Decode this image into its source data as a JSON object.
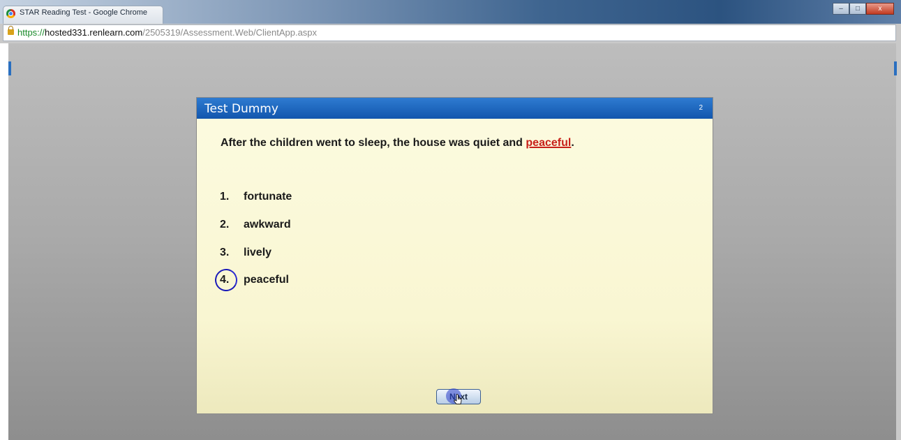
{
  "browser": {
    "window_title": "STAR Reading Test - Google Chrome",
    "url_scheme": "https://",
    "url_host": "hosted331.renlearn.com",
    "url_path": "/2505319/Assessment.Web/ClientApp.aspx",
    "controls": {
      "minimize": "–",
      "maximize": "□",
      "close": "x"
    }
  },
  "test": {
    "student_name": "Test Dummy",
    "question_number": "2",
    "question_text": "After the children went to sleep, the house was quiet and ",
    "underlined_word": "peaceful",
    "question_end": ".",
    "choices": [
      {
        "number": "1.",
        "text": "fortunate"
      },
      {
        "number": "2.",
        "text": "awkward"
      },
      {
        "number": "3.",
        "text": "lively"
      },
      {
        "number": "4.",
        "text": "peaceful"
      }
    ],
    "selected_choice": 4,
    "next_label": "Next"
  },
  "colors": {
    "header_blue": "#1a62b8",
    "background_cream": "#fcfbe0",
    "underline_red": "#c8201a",
    "selection_circle": "#1a1ab8"
  },
  "icons": [
    "chrome-icon",
    "lock-icon",
    "mouse-cursor-icon",
    "selection-circle-icon"
  ]
}
